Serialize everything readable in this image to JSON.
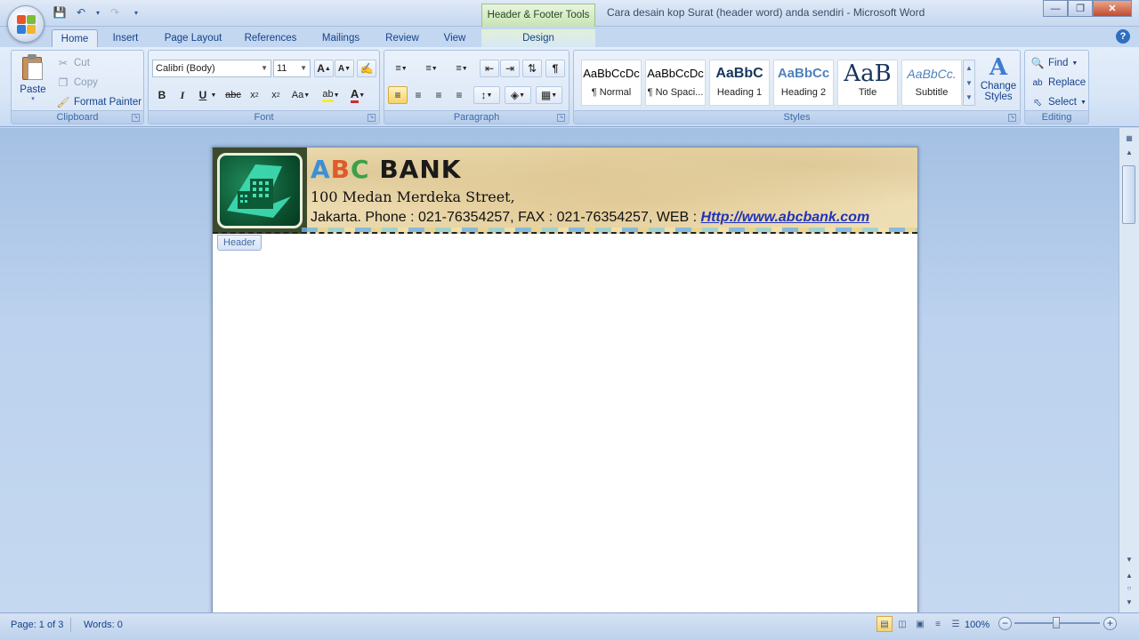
{
  "window": {
    "title": "Cara desain kop Surat (header word) anda sendiri - Microsoft Word",
    "contextual_tab_title": "Header & Footer Tools"
  },
  "tabs": [
    {
      "label": "Home",
      "active": true
    },
    {
      "label": "Insert"
    },
    {
      "label": "Page Layout"
    },
    {
      "label": "References"
    },
    {
      "label": "Mailings"
    },
    {
      "label": "Review"
    },
    {
      "label": "View"
    },
    {
      "label": "Design"
    }
  ],
  "ribbon": {
    "clipboard": {
      "label": "Clipboard",
      "paste": "Paste",
      "cut": "Cut",
      "copy": "Copy",
      "format_painter": "Format Painter"
    },
    "font": {
      "label": "Font",
      "font_name": "Calibri (Body)",
      "font_size": "11"
    },
    "paragraph": {
      "label": "Paragraph"
    },
    "styles": {
      "label": "Styles",
      "items": [
        {
          "sample": "AaBbCcDc",
          "name": "¶ Normal"
        },
        {
          "sample": "AaBbCcDc",
          "name": "¶ No Spaci..."
        },
        {
          "sample": "AaBbC",
          "name": "Heading 1"
        },
        {
          "sample": "AaBbCc",
          "name": "Heading 2"
        },
        {
          "sample": "AaB",
          "name": "Title"
        },
        {
          "sample": "AaBbCc.",
          "name": "Subtitle"
        }
      ],
      "change_styles": "Change Styles"
    },
    "editing": {
      "label": "Editing",
      "find": "Find",
      "replace": "Replace",
      "select": "Select"
    }
  },
  "document": {
    "letterhead": {
      "bank_letters": [
        "A",
        "B",
        "C"
      ],
      "bank_rest": "BANK",
      "address_line1": "100 Medan Merdeka Street,",
      "address_line2": "Jakarta. Phone : 021-76354257, FAX : 021-76354257, WEB : ",
      "website": "Http://www.abcbank.com"
    },
    "header_tag": "Header"
  },
  "statusbar": {
    "page": "Page: 1 of 3",
    "words": "Words: 0",
    "zoom": "100%"
  },
  "colors": {
    "accent": "#15428b",
    "ribbon_bg": "#dbe7f7",
    "letter_a": "#3d8fd6",
    "letter_b": "#e05a2a",
    "letter_c": "#3aa14a",
    "link": "#1f33b8"
  }
}
